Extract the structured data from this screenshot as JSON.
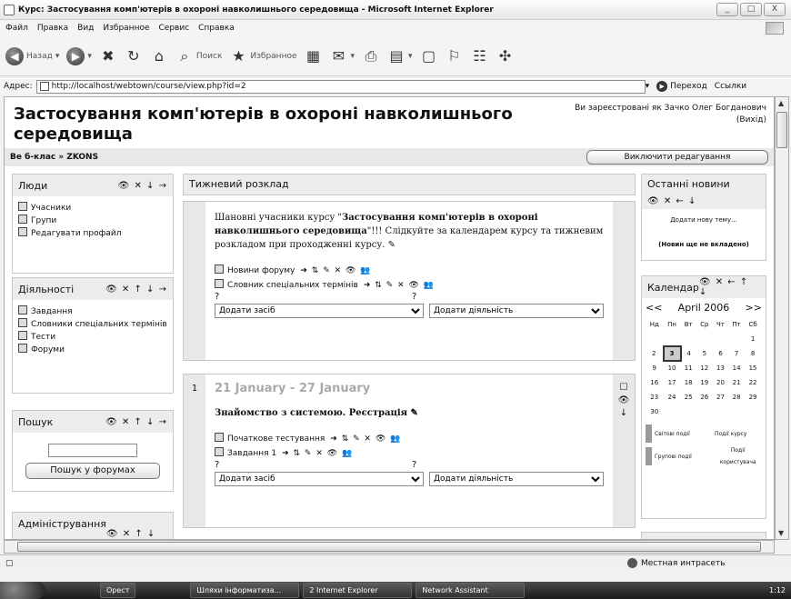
{
  "window": {
    "title": "Курс: Застосування комп'ютерів в охороні навколишнього середовища - Microsoft Internet Explorer",
    "controls": [
      "_",
      "□",
      "X"
    ]
  },
  "menu": [
    "Файл",
    "Правка",
    "Вид",
    "Избранное",
    "Сервис",
    "Справка"
  ],
  "toolbar": {
    "back": "Назад",
    "search": "Поиск",
    "favorites": "Избранное"
  },
  "address": {
    "label": "Адрес:",
    "url": "http://localhost/webtown/course/view.php?id=2",
    "go": "Переход",
    "links": "Ссылки"
  },
  "page": {
    "course_title": "Застосування комп'ютерів в охороні навколишнього середовища",
    "login": "Ви зареєстровані як Зачко Олег Богданович",
    "logout": "(Вихід)",
    "breadcrumb": "Ве б-клас » ZKONS",
    "edit_button": "Виключити редагування"
  },
  "blocks": {
    "people": {
      "title": "Люди",
      "controls": "👁 ✕ ↓ →",
      "items": [
        "Учасники",
        "Групи",
        "Редагувати профайл"
      ]
    },
    "activities": {
      "title": "Діяльності",
      "controls": "👁 ✕ ↑ ↓ →",
      "items": [
        "Завдання",
        "Словники спеціальних термінів",
        "Тести",
        "Форуми"
      ]
    },
    "search": {
      "title": "Пошук",
      "controls": "👁 ✕ ↑ ↓ →",
      "button": "Пошук у форумах"
    },
    "admin": {
      "title": "Адміністрування",
      "controls": "👁 ✕ ↑ ↓ →"
    },
    "news": {
      "title": "Останні новини",
      "controls": "👁 ✕ ← ↓",
      "add": "Додати нову тему...",
      "empty": "(Новин ще не вкладено)"
    },
    "calendar": {
      "title": "Календар",
      "controls": "👁 ✕ ← ↑ ↓",
      "prev": "<<",
      "next": ">>",
      "month": "April 2006",
      "weekdays": [
        "Нд",
        "Пн",
        "Вт",
        "Ср",
        "Чт",
        "Пт",
        "Сб"
      ],
      "weeks": [
        [
          "",
          "",
          "",
          "",
          "",
          "",
          "1"
        ],
        [
          "2",
          "3",
          "4",
          "5",
          "6",
          "7",
          "8"
        ],
        [
          "9",
          "10",
          "11",
          "12",
          "13",
          "14",
          "15"
        ],
        [
          "16",
          "17",
          "18",
          "19",
          "20",
          "21",
          "22"
        ],
        [
          "23",
          "24",
          "25",
          "26",
          "27",
          "28",
          "29"
        ],
        [
          "30",
          "",
          "",
          "",
          "",
          "",
          ""
        ]
      ],
      "today": "3",
      "legend": [
        "Світові події",
        "Події курсу",
        "Групові події",
        "Події користувача"
      ]
    }
  },
  "main": {
    "heading": "Тижневий розклад",
    "summary_pre": "Шановні учасники курсу \"",
    "summary_bold": "Застосування комп'ютерів в охороні навколишнього середовища",
    "summary_post": "\"!!! Слідкуйте за календарем курсу та тижневим розкладом при проходженні курсу. ✎",
    "section0_items": [
      "Новини форуму",
      "Словник спеціальних термінів"
    ],
    "edit_icons": "➜ ⇅ ✎ ✕ 👁 👥",
    "help": "?",
    "add_resource": "Додати засіб",
    "add_activity": "Додати діяльність",
    "week1": {
      "number": "1",
      "date": "21 January - 27 January",
      "title": "Знайомство з системою. Реєстрація ✎",
      "items": [
        "Початкове тестування",
        "Завдання 1"
      ]
    }
  },
  "status": {
    "zone": "Местная интрасеть"
  },
  "taskbar": {
    "items": [
      "Орест",
      "Шляхи інформатиза...",
      "2 Internet Explorer",
      "Network Assistant"
    ],
    "clock": "1:12"
  }
}
